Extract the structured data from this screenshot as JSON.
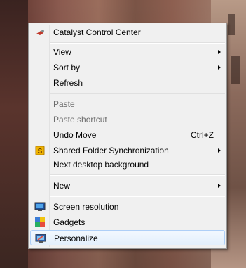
{
  "menu": {
    "items": [
      {
        "label": "Catalyst Control Center",
        "icon": "catalyst-icon"
      },
      {
        "label": "View"
      },
      {
        "label": "Sort by"
      },
      {
        "label": "Refresh"
      },
      {
        "label": "Paste"
      },
      {
        "label": "Paste shortcut"
      },
      {
        "label": "Undo Move",
        "shortcut": "Ctrl+Z"
      },
      {
        "label": "Shared Folder Synchronization",
        "icon": "sync-icon"
      },
      {
        "label": "Next desktop background"
      },
      {
        "label": "New"
      },
      {
        "label": "Screen resolution",
        "icon": "monitor-icon"
      },
      {
        "label": "Gadgets",
        "icon": "gadgets-icon"
      },
      {
        "label": "Personalize",
        "icon": "personalize-icon"
      }
    ]
  }
}
